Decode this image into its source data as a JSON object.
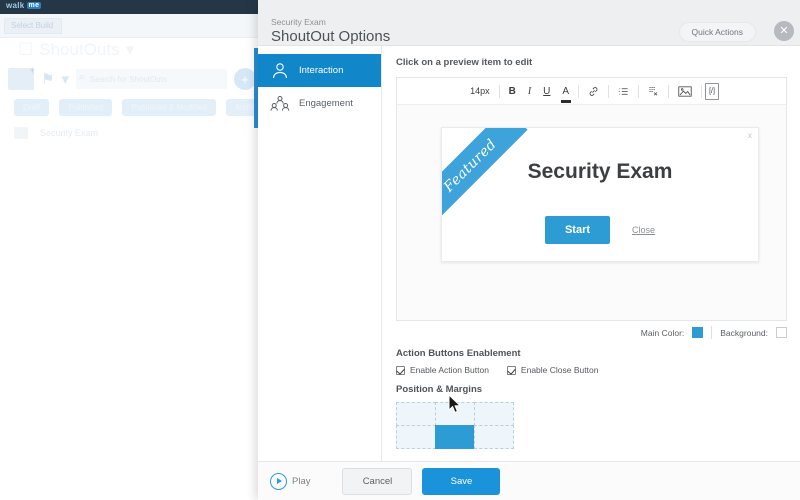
{
  "background_app": {
    "logo": "walk",
    "logo_accent": "me",
    "tab_label": "Select Build",
    "page_title": "ShoutOuts",
    "search_placeholder": "Search for ShoutOuts",
    "filter_pills": [
      "Draft",
      "Published",
      "Published & Modified",
      "Archived"
    ],
    "list_items": [
      "Security Exam"
    ],
    "icons": {
      "new_folder": "new-folder-icon",
      "tag": "tag-icon",
      "filter": "filter-icon",
      "search": "search-icon",
      "add": "add-icon"
    }
  },
  "modal": {
    "subtitle": "Security Exam",
    "title": "ShoutOut Options",
    "quick_actions_label": "Quick Actions",
    "close_label": "✕",
    "sidebar": {
      "items": [
        {
          "label": "Interaction",
          "icon": "user-circle-icon",
          "active": true
        },
        {
          "label": "Engagement",
          "icon": "group-people-icon",
          "active": false
        }
      ]
    },
    "content": {
      "hint": "Click on a preview item to edit",
      "toolbar": {
        "font_size": "14px",
        "bold": "B",
        "italic": "I",
        "underline": "U",
        "text_color": "A",
        "link": "link-icon",
        "list": "list-icon",
        "clear_format": "clear-formatting-icon",
        "image": "image-icon",
        "code": "[/]"
      },
      "preview": {
        "ribbon": "Featured",
        "title": "Security Exam",
        "action_button": "Start",
        "close_link": "Close",
        "dismiss": "x"
      },
      "colors": {
        "main_color_label": "Main Color:",
        "main_color_value": "#2e9cd4",
        "background_label": "Background:",
        "background_value": "#ffffff"
      },
      "action_buttons": {
        "section_title": "Action Buttons Enablement",
        "enable_action": "Enable Action Button",
        "enable_close": "Enable Close Button"
      },
      "position": {
        "section_title": "Position & Margins",
        "cells": [
          {
            "selected": false
          },
          {
            "selected": false
          },
          {
            "selected": false
          },
          {
            "selected": false
          },
          {
            "selected": true
          },
          {
            "selected": false
          }
        ]
      }
    },
    "footer": {
      "play_label": "Play",
      "cancel_label": "Cancel",
      "save_label": "Save"
    }
  }
}
